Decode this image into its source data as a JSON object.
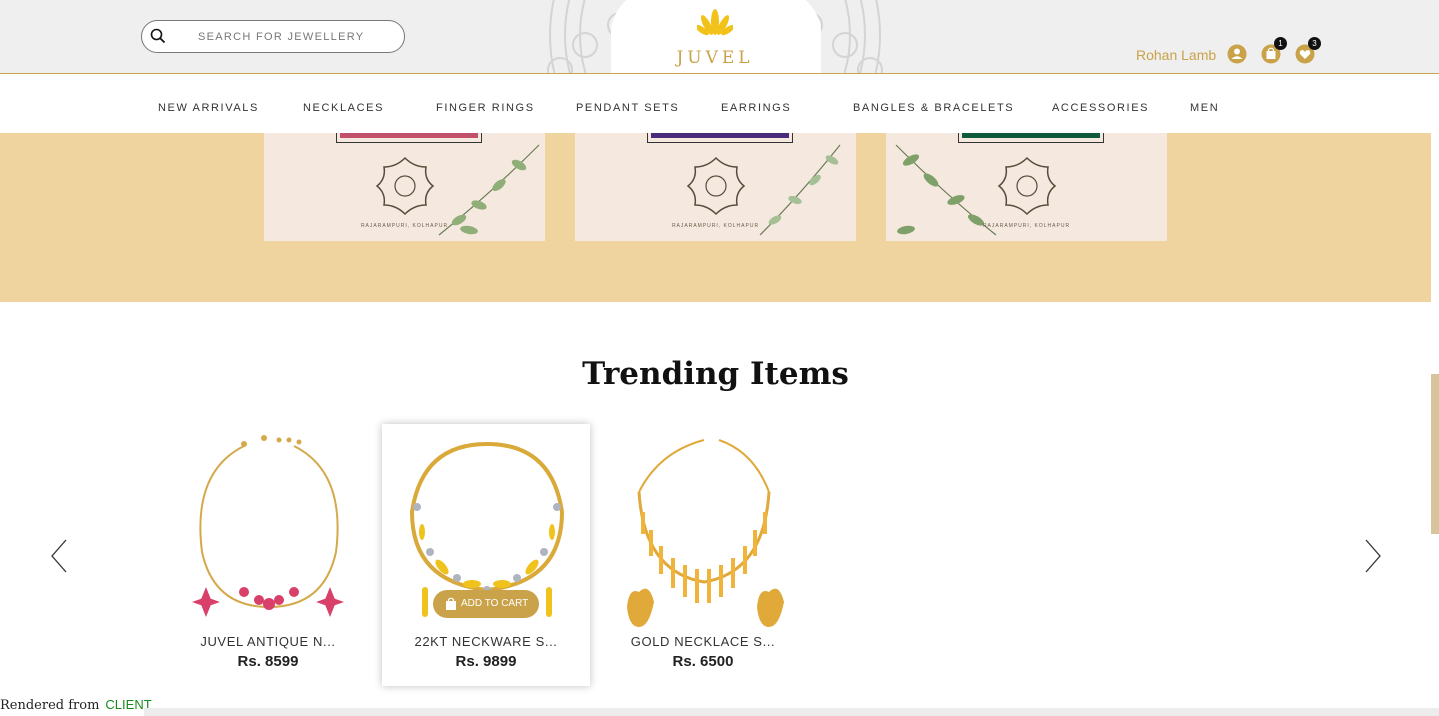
{
  "header": {
    "logo_text": "JUVEL",
    "search": {
      "placeholder": "SEARCH FOR JEWELLERY",
      "value": ""
    },
    "user_name": "Rohan Lamb",
    "cart_count": "1",
    "wishlist_count": "3",
    "icons": [
      "search-icon",
      "user-icon",
      "cart-icon",
      "wishlist-icon"
    ]
  },
  "nav": {
    "items": [
      "NEW ARRIVALS",
      "NECKLACES",
      "FINGER RINGS",
      "PENDANT SETS",
      "EARRINGS",
      "BANGLES & BRACELETS",
      "ACCESSORIES",
      "MEN"
    ]
  },
  "banner": {
    "cards": [
      {
        "caption": "RAJARAMPURI, KOLHAPUR",
        "stripe_color": "#c2506a"
      },
      {
        "caption": "RAJARAMPURI, KOLHAPUR",
        "stripe_color": "#4a2a7a"
      },
      {
        "caption": "RAJARAMPURI, KOLHAPUR",
        "stripe_color": "#0f5a3a"
      }
    ]
  },
  "trending": {
    "title": "Trending Items",
    "products": [
      {
        "name": "JUVEL ANTIQUE N...",
        "price": "Rs. 8599"
      },
      {
        "name": "22KT NECKWARE S...",
        "price": "Rs. 9899",
        "cart_label": "ADD TO CART"
      },
      {
        "name": "GOLD NECKLACE S...",
        "price": "Rs. 6500"
      }
    ]
  },
  "footer": {
    "rendered_from": "Rendered from",
    "source": "CLIENT"
  },
  "colors": {
    "accent": "#c9a24a",
    "banner_bg": "#efd4a0"
  }
}
